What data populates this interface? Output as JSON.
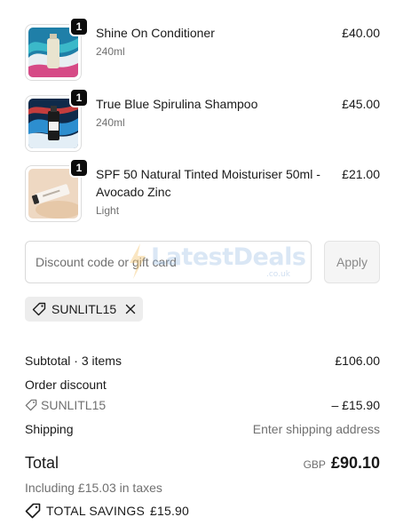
{
  "items": [
    {
      "name": "Shine On Conditioner",
      "variant": "240ml",
      "price": "£40.00",
      "qty": "1"
    },
    {
      "name": "True Blue Spirulina Shampoo",
      "variant": "240ml",
      "price": "£45.00",
      "qty": "1"
    },
    {
      "name": "SPF 50 Natural Tinted Moisturiser 50ml - Avocado Zinc",
      "variant": "Light",
      "price": "£21.00",
      "qty": "1"
    }
  ],
  "discount": {
    "placeholder": "Discount code or gift card",
    "apply_label": "Apply",
    "applied_code": "SUNLITL15"
  },
  "watermark": {
    "text": "LatestDeals",
    "sub": ".co.uk"
  },
  "summary": {
    "subtotal_label": "Subtotal · 3 items",
    "subtotal_value": "£106.00",
    "order_discount_label": "Order discount",
    "discount_code": "SUNLITL15",
    "discount_value": "– £15.90",
    "shipping_label": "Shipping",
    "shipping_value": "Enter shipping address",
    "total_label": "Total",
    "currency": "GBP",
    "total_value": "£90.10",
    "taxes_note": "Including £15.03 in taxes",
    "savings_label": "TOTAL SAVINGS",
    "savings_value": "£15.90"
  },
  "icons": {
    "tag": "tag-icon",
    "close": "close-icon",
    "savings": "savings-tag-icon"
  },
  "colors": {
    "text": "#1a1a1a",
    "muted": "#707070",
    "badge": "#0c0c0c",
    "chip_bg": "#ededed"
  }
}
